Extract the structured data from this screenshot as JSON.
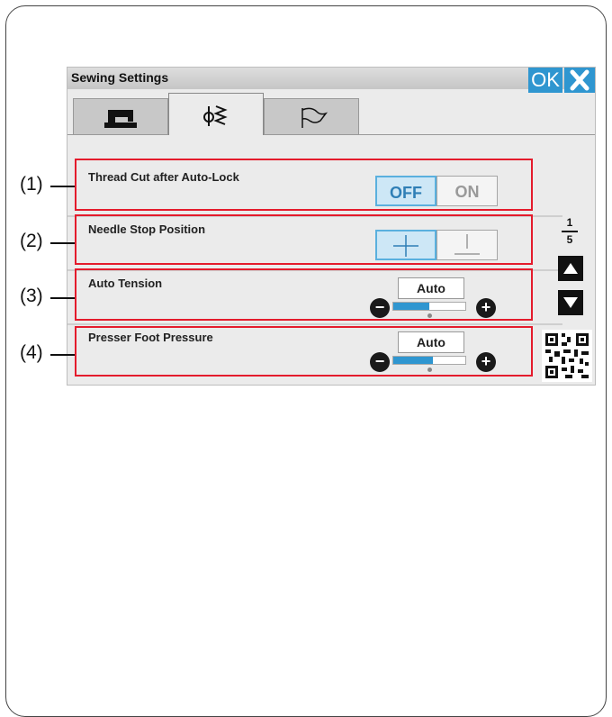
{
  "window": {
    "title": "Sewing Settings",
    "ok_label": "OK"
  },
  "tabs": [
    {
      "name": "machine-tab",
      "icon": "sewing-machine-icon",
      "active": false
    },
    {
      "name": "stitch-settings-tab",
      "icon": "needle-stitch-icon",
      "active": true
    },
    {
      "name": "language-tab",
      "icon": "flag-icon",
      "active": false
    }
  ],
  "callouts": [
    "(1)",
    "(2)",
    "(3)",
    "(4)"
  ],
  "settings": {
    "thread_cut": {
      "label": "Thread Cut after Auto-Lock",
      "off_label": "OFF",
      "on_label": "ON",
      "selected": "OFF"
    },
    "needle_stop": {
      "label": "Needle Stop Position",
      "options": [
        "needle-up-icon",
        "needle-down-icon"
      ],
      "selected": "needle-up-icon"
    },
    "auto_tension": {
      "label": "Auto Tension",
      "value": "Auto",
      "level": 0.5
    },
    "presser_foot": {
      "label": "Presser Foot Pressure",
      "value": "Auto",
      "level": 0.55
    }
  },
  "pagination": {
    "current": "1",
    "total": "5"
  },
  "colors": {
    "accent": "#2f96d0",
    "callout_box": "#e41b2c",
    "selected_bg": "#cde7f6"
  }
}
